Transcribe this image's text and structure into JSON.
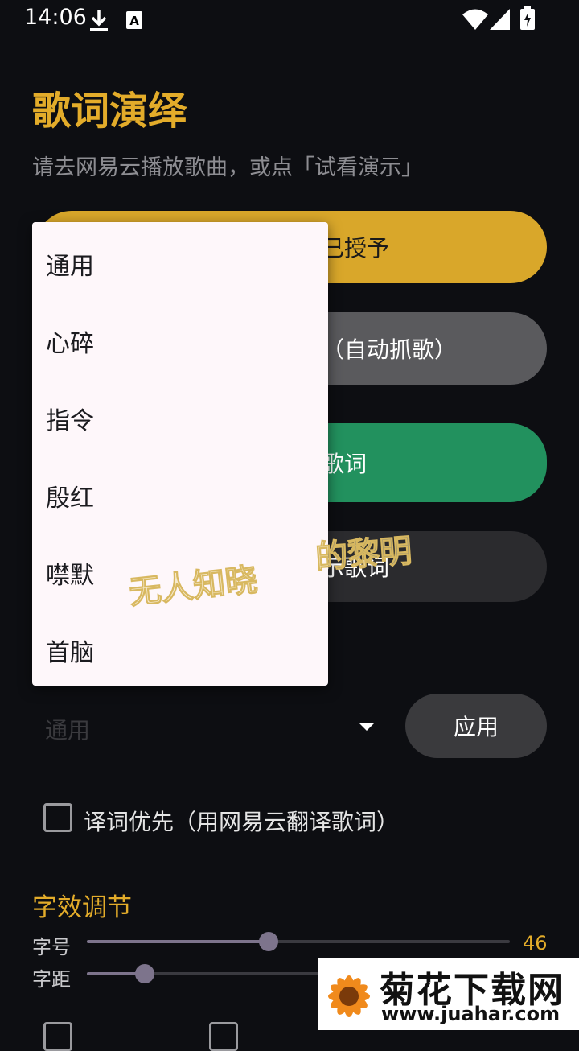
{
  "status_bar": {
    "time": "14:06",
    "icons": [
      "download-icon",
      "keyboard-a-icon",
      "wifi-icon",
      "signal-icon",
      "battery-charging-icon"
    ]
  },
  "header": {
    "title": "歌词演绎",
    "subtitle": "请去网易云播放歌曲，或点「试看演示」"
  },
  "buttons": {
    "btn1_label": "已授予",
    "btn2_label": "（自动抓歌）",
    "btn3_label": "歌词",
    "btn4_label": "示歌词"
  },
  "style_select": {
    "selected": "通用",
    "apply_label": "应用"
  },
  "menu": {
    "items": [
      {
        "label": "通用"
      },
      {
        "label": "心碎"
      },
      {
        "label": "指令"
      },
      {
        "label": "殷红"
      },
      {
        "label": "噤默"
      },
      {
        "label": "首脑"
      }
    ]
  },
  "watermark_text": {
    "part1": "无人知晓",
    "part2": "的黎明"
  },
  "translation_checkbox": {
    "label": "译词优先（用网易云翻译歌词）",
    "checked": false
  },
  "font_adjust": {
    "section_title": "字效调节",
    "size": {
      "label": "字号",
      "value": "46",
      "fraction": 0.43
    },
    "spacing": {
      "label": "字距",
      "fraction": 0.25
    }
  },
  "colors": {
    "accent": "#e3ac2a",
    "green": "#22915e",
    "background": "#0d0e12"
  },
  "logo": {
    "main": "菊花下载网",
    "url": "www.juahar.com"
  }
}
